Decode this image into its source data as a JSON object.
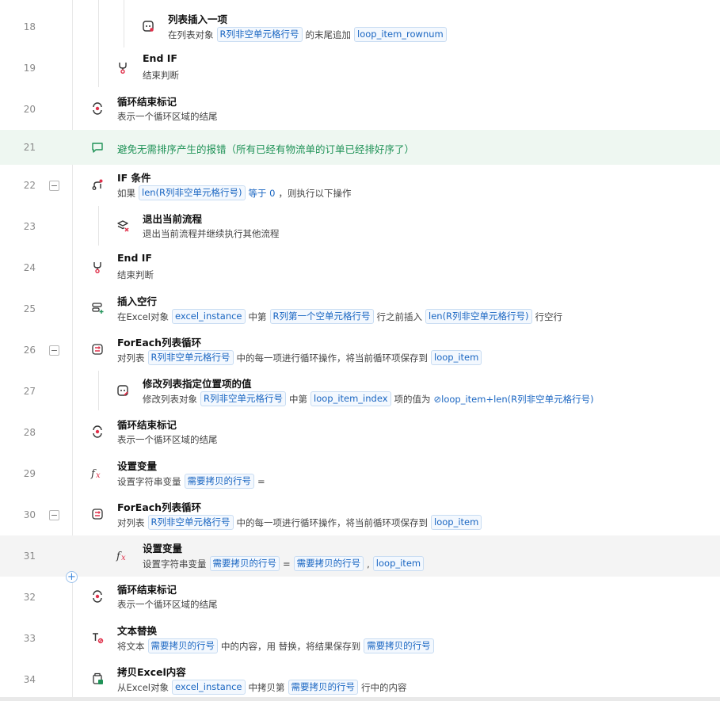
{
  "rows": [
    {
      "line": "18",
      "title": "列表插入一项",
      "desc": [
        {
          "t": "在列表对象"
        },
        {
          "tag": "R列非空单元格行号"
        },
        {
          "t": "的末尾追加"
        },
        {
          "tag": "loop_item_rownum"
        }
      ]
    },
    {
      "line": "19",
      "title": "End IF",
      "desc": [
        {
          "t": "结束判断"
        }
      ]
    },
    {
      "line": "20",
      "title": "循环结束标记",
      "desc": [
        {
          "t": "表示一个循环区域的结尾"
        }
      ]
    },
    {
      "line": "21",
      "comment": "避免无需排序产生的报错（所有已经有物流单的订单已经排好序了）"
    },
    {
      "line": "22",
      "title": "IF 条件",
      "desc": [
        {
          "t": "如果"
        },
        {
          "tag": "len(R列非空单元格行号)"
        },
        {
          "t": "等于 0"
        },
        {
          "t": "，则执行以下操作"
        }
      ]
    },
    {
      "line": "23",
      "title": "退出当前流程",
      "desc": [
        {
          "t": "退出当前流程并继续执行其他流程"
        }
      ]
    },
    {
      "line": "24",
      "title": "End IF",
      "desc": [
        {
          "t": "结束判断"
        }
      ]
    },
    {
      "line": "25",
      "title": "插入空行",
      "desc": [
        {
          "t": "在Excel对象"
        },
        {
          "tag": "excel_instance"
        },
        {
          "t": "中第"
        },
        {
          "tag": "R列第一个空单元格行号"
        },
        {
          "t": "行之前插入"
        },
        {
          "tag": "len(R列非空单元格行号)"
        },
        {
          "t": "行空行"
        }
      ]
    },
    {
      "line": "26",
      "title": "ForEach列表循环",
      "desc": [
        {
          "t": "对列表"
        },
        {
          "tag": "R列非空单元格行号"
        },
        {
          "t": "中的每一项进行循环操作，将当前循环项保存到"
        },
        {
          "tag": "loop_item"
        }
      ]
    },
    {
      "line": "27",
      "title": "修改列表指定位置项的值",
      "desc": [
        {
          "t": "修改列表对象"
        },
        {
          "tag": "R列非空单元格行号"
        },
        {
          "t": "中第"
        },
        {
          "tag": "loop_item_index"
        },
        {
          "t": "项的值为"
        },
        {
          "expr": "⊘loop_item+len(R列非空单元格行号)"
        }
      ]
    },
    {
      "line": "28",
      "title": "循环结束标记",
      "desc": [
        {
          "t": "表示一个循环区域的结尾"
        }
      ]
    },
    {
      "line": "29",
      "title": "设置变量",
      "desc": [
        {
          "t": "设置字符串变量"
        },
        {
          "tag": "需要拷贝的行号"
        },
        {
          "t": "="
        }
      ]
    },
    {
      "line": "30",
      "title": "ForEach列表循环",
      "desc": [
        {
          "t": "对列表"
        },
        {
          "tag": "R列非空单元格行号"
        },
        {
          "t": "中的每一项进行循环操作，将当前循环项保存到"
        },
        {
          "tag": "loop_item"
        }
      ]
    },
    {
      "line": "31",
      "title": "设置变量",
      "desc": [
        {
          "t": "设置字符串变量"
        },
        {
          "tag": "需要拷贝的行号"
        },
        {
          "t": "="
        },
        {
          "tag": "需要拷贝的行号"
        },
        {
          "t": ","
        },
        {
          "tag": "loop_item"
        }
      ]
    },
    {
      "line": "32",
      "title": "循环结束标记",
      "desc": [
        {
          "t": "表示一个循环区域的结尾"
        }
      ]
    },
    {
      "line": "33",
      "title": "文本替换",
      "desc": [
        {
          "t": "将文本"
        },
        {
          "tag": "需要拷贝的行号"
        },
        {
          "t": "中的内容，用 替换，将结果保存到"
        },
        {
          "tag": "需要拷贝的行号"
        }
      ]
    },
    {
      "line": "34",
      "title": "拷贝Excel内容",
      "desc": [
        {
          "t": "从Excel对象"
        },
        {
          "tag": "excel_instance"
        },
        {
          "t": "中拷贝第"
        },
        {
          "tag": "需要拷贝的行号"
        },
        {
          "t": "行中的内容"
        }
      ]
    }
  ],
  "collapse_symbol": "−",
  "add_symbol": "+",
  "colors": {
    "accent": "#1a66c2",
    "comment": "#1f9257",
    "icon_red": "#e0314b"
  }
}
